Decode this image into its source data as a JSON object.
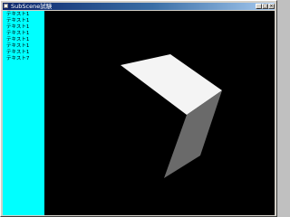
{
  "window": {
    "title": "SubScene試験",
    "controls": {
      "minimize": "_",
      "maximize": "□",
      "close": "×"
    }
  },
  "side_panel": {
    "background": "#00ffff",
    "labels": [
      "テキスト1",
      "テキスト1",
      "テキスト1",
      "テキスト1",
      "テキスト1",
      "テキスト1",
      "テキスト1",
      "テキスト7"
    ]
  },
  "scene": {
    "background": "#000000",
    "top_face_color": "#f4f4f4",
    "side_face_color": "#6a6a6a"
  }
}
